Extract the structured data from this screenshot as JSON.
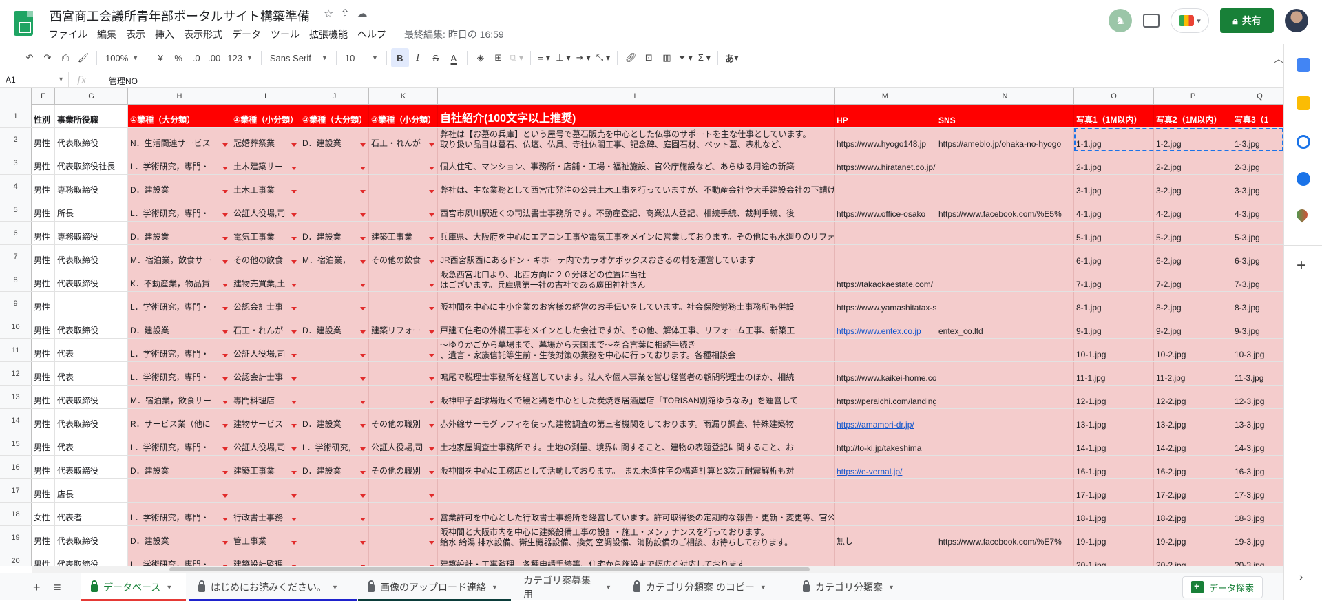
{
  "doc": {
    "title": "西宮商工会議所青年部ポータルサイト構築準備",
    "last_edit": "最終編集: 昨日の 16:59",
    "share_label": "共有"
  },
  "menu": [
    "ファイル",
    "編集",
    "表示",
    "挿入",
    "表示形式",
    "データ",
    "ツール",
    "拡張機能",
    "ヘルプ"
  ],
  "toolbar": {
    "zoom": "100%",
    "currency": "¥",
    "percent": "%",
    "dec_less": ".0",
    "dec_more": ".00",
    "format": "123",
    "font": "Sans Serif",
    "font_size": "10",
    "input_tool": "あ"
  },
  "formula": {
    "cell_ref": "A1",
    "fx": "fx",
    "content": "管理NO"
  },
  "columns": [
    "F",
    "G",
    "H",
    "I",
    "J",
    "K",
    "L",
    "M",
    "N",
    "O",
    "P",
    "Q"
  ],
  "header_row": [
    "性別",
    "事業所役職",
    "①業種（大分類）",
    "①業種（小分類）",
    "②業種（大分類）",
    "②業種（小分類）",
    "自社紹介(100文字以上推奨)",
    "HP",
    "SNS",
    "写真1（1M以内）",
    "写真2（1M以内）",
    "写真3（1"
  ],
  "rows": [
    {
      "n": "2",
      "c": [
        "男性",
        "代表取締役",
        "N．生活関連サービス",
        "冠婚葬祭業",
        "D．建設業",
        "石工・れんが",
        "弊社は【お墓の兵庫】という屋号で墓石販売を中心とした仏事のサポートを主な仕事としています。\n取り扱い品目は墓石、仏壇、仏具、寺社仏閣工事、記念碑、庭園石材、ペット墓、表札など、",
        "https://www.hyogo148.jp",
        "https://ameblo.jp/ohaka-no-hyogo",
        "1-1.jpg",
        "1-2.jpg",
        "1-3.jpg"
      ]
    },
    {
      "n": "3",
      "c": [
        "男性",
        "代表取締役社長",
        "L．学術研究，専門・",
        "土木建築サー",
        "",
        "",
        "個人住宅、マンション、事務所・店舗・工場・福祉施設、官公庁施設など、あらゆる用途の新築",
        "https://www.hiratanet.co.jp/",
        "",
        "2-1.jpg",
        "2-2.jpg",
        "2-3.jpg"
      ]
    },
    {
      "n": "4",
      "c": [
        "男性",
        "専務取締役",
        "D．建設業",
        "土木工事業",
        "",
        "",
        "弊社は、主な業務として西宮市発注の公共土木工事を行っていますが、不動産会社や大手建設会社の下請けとして、また西宮市や西宮建設協会のご紹介を",
        "",
        "",
        "3-1.jpg",
        "3-2.jpg",
        "3-3.jpg"
      ]
    },
    {
      "n": "5",
      "c": [
        "男性",
        "所長",
        "L．学術研究，専門・",
        "公証人役場,司",
        "",
        "",
        "西宮市夙川駅近くの司法書士事務所です。不動産登記、商業法人登記、相続手続、裁判手続、後",
        "https://www.office-osako",
        "https://www.facebook.com/%E5%",
        "4-1.jpg",
        "4-2.jpg",
        "4-3.jpg"
      ]
    },
    {
      "n": "6",
      "c": [
        "男性",
        "専務取締役",
        "D．建設業",
        "電気工事業",
        "D．建設業",
        "建築工事業",
        "兵庫県、大阪府を中心にエアコン工事や電気工事をメインに営業しております。その他にも水廻りのリフォームや店舗改装等も行っておりますので、お家の",
        "",
        "",
        "5-1.jpg",
        "5-2.jpg",
        "5-3.jpg"
      ]
    },
    {
      "n": "7",
      "c": [
        "男性",
        "代表取締役",
        "M．宿泊業，飲食サー",
        "その他の飲食",
        "M．宿泊業，",
        "その他の飲食",
        "JR西宮駅西にあるドン・キホーテ内でカラオケボックスおさるの村を運営しています",
        "",
        "",
        "6-1.jpg",
        "6-2.jpg",
        "6-3.jpg"
      ]
    },
    {
      "n": "8",
      "c": [
        "男性",
        "代表取締役",
        "K．不動産業，物品賃",
        "建物売買業,土",
        "",
        "",
        "阪急西宮北口より、北西方向に２０分ほどの位置に当社\nはございます。兵庫県第一社の古社である廣田神社さん",
        "https://takaokaestate.com/",
        "",
        "7-1.jpg",
        "7-2.jpg",
        "7-3.jpg"
      ]
    },
    {
      "n": "9",
      "c": [
        "男性",
        "",
        "L．学術研究，専門・",
        "公認会計士事",
        "",
        "",
        "阪神間を中心に中小企業のお客様の経営のお手伝いをしています。社会保険労務士事務所も併設",
        "https://www.yamashitatax-sr.jp/",
        "",
        "8-1.jpg",
        "8-2.jpg",
        "8-3.jpg"
      ]
    },
    {
      "n": "10",
      "c": [
        "男性",
        "代表取締役",
        "D．建設業",
        "石工・れんが",
        "D．建設業",
        "建築リフォー",
        "戸建て住宅の外構工事をメインとした会社ですが、その他、解体工事、リフォーム工事、新築工",
        "https://www.entex.co.jp",
        "entex_co.ltd",
        "9-1.jpg",
        "9-2.jpg",
        "9-3.jpg"
      ]
    },
    {
      "n": "11",
      "c": [
        "男性",
        "代表",
        "L．学術研究，専門・",
        "公証人役場,司",
        "",
        "",
        "～ゆりかごから墓場まで、墓場から天国まで～を合言葉に相続手続き\n、遺言・家族信託等生前・生後対策の業務を中心に行っております。各種相談会",
        "",
        "",
        "10-1.jpg",
        "10-2.jpg",
        "10-3.jpg"
      ]
    },
    {
      "n": "12",
      "c": [
        "男性",
        "代表",
        "L．学術研究，専門・",
        "公認会計士事",
        "",
        "",
        "鳴尾で税理士事務所を経営しています。法人や個人事業を営む経営者の顧問税理士のほか、相続",
        "https://www.kaikei-home.com/taku-tax/",
        "",
        "11-1.jpg",
        "11-2.jpg",
        "11-3.jpg"
      ]
    },
    {
      "n": "13",
      "c": [
        "男性",
        "代表取締役",
        "M．宿泊業，飲食サー",
        "専門料理店",
        "",
        "",
        "阪神甲子園球場近くで鰻と鶏を中心とした炭焼き居酒屋店「TORISAN別館ゆうなみ」を運営して",
        "https://peraichi.com/landing_pages/view/n59b2/",
        "",
        "12-1.jpg",
        "12-2.jpg",
        "12-3.jpg"
      ]
    },
    {
      "n": "14",
      "c": [
        "男性",
        "代表取締役",
        "R．サービス業（他に",
        "建物サービス",
        "D．建設業",
        "その他の職別",
        "赤外線サーモグラフィを使った建物調査の第三者機関をしております。雨漏り調査、特殊建築物",
        "https://amamori-dr.jp/",
        "",
        "13-1.jpg",
        "13-2.jpg",
        "13-3.jpg"
      ]
    },
    {
      "n": "15",
      "c": [
        "男性",
        "代表",
        "L．学術研究，専門・",
        "公証人役場,司",
        "L．学術研究,",
        "公証人役場,司",
        "土地家屋調査士事務所です。土地の測量、境界に関すること、建物の表題登記に関すること、お",
        "http://to-ki.jp/takeshima",
        "",
        "14-1.jpg",
        "14-2.jpg",
        "14-3.jpg"
      ]
    },
    {
      "n": "16",
      "c": [
        "男性",
        "代表取締役",
        "D．建設業",
        "建築工事業",
        "D．建設業",
        "その他の職別",
        "阪神間を中心に工務店として活動しております。　また木造住宅の構造計算と3次元耐震解析も対",
        "https://e-vernal.jp/",
        "",
        "16-1.jpg",
        "16-2.jpg",
        "16-3.jpg"
      ]
    },
    {
      "n": "17",
      "c": [
        "男性",
        "店長",
        "",
        "",
        "",
        "",
        "",
        "",
        "",
        "17-1.jpg",
        "17-2.jpg",
        "17-3.jpg"
      ]
    },
    {
      "n": "18",
      "c": [
        "女性",
        "代表者",
        "L．学術研究，専門・",
        "行政書士事務",
        "",
        "",
        "営業許可を中心とした行政書士事務所を経営しています。許可取得後の定期的な報告・更新・変更等、官公庁へ提出する書類は多岐に渡りますので事業主",
        "",
        "",
        "18-1.jpg",
        "18-2.jpg",
        "18-3.jpg"
      ]
    },
    {
      "n": "19",
      "c": [
        "男性",
        "代表取締役",
        "D．建設業",
        "管工事業",
        "",
        "",
        "阪神間と大阪市内を中心に建築設備工事の設計・施工・メンテナンスを行っております。\n給水 給湯 排水設備、衛生機器設備、換気 空調設備、消防設備のご相談、お待ちしております。",
        "無し",
        "https://www.facebook.com/%E7%",
        "19-1.jpg",
        "19-2.jpg",
        "19-3.jpg"
      ]
    },
    {
      "n": "20",
      "c": [
        "男性",
        "代表取締役",
        "L．学術研究，専門・",
        "建築設計監理",
        "",
        "",
        "建築設計・工事監理…各種申請手続等、住宅から施設まで幅広く対応しております",
        "",
        "",
        "20-1.jpg",
        "20-2.jpg",
        "20-3.jpg"
      ]
    }
  ],
  "sheets": [
    {
      "label": "データベース",
      "locked": true,
      "color": "#e53935"
    },
    {
      "label": "はじめにお読みください。",
      "locked": true,
      "color": "#1e22cc"
    },
    {
      "label": "画像のアップロード連絡",
      "locked": true,
      "color": "#0b3d3a"
    },
    {
      "label": "カテゴリ案募集用",
      "locked": false,
      "color": ""
    },
    {
      "label": "カテゴリ分類案 のコピー",
      "locked": true,
      "color": ""
    },
    {
      "label": "カテゴリ分類案",
      "locked": true,
      "color": ""
    }
  ],
  "explore_label": "データ探索",
  "colors": {
    "accent_green": "#188038",
    "header_red": "#ff0000",
    "row_pink": "#f4cccc",
    "link_blue": "#1155cc"
  }
}
